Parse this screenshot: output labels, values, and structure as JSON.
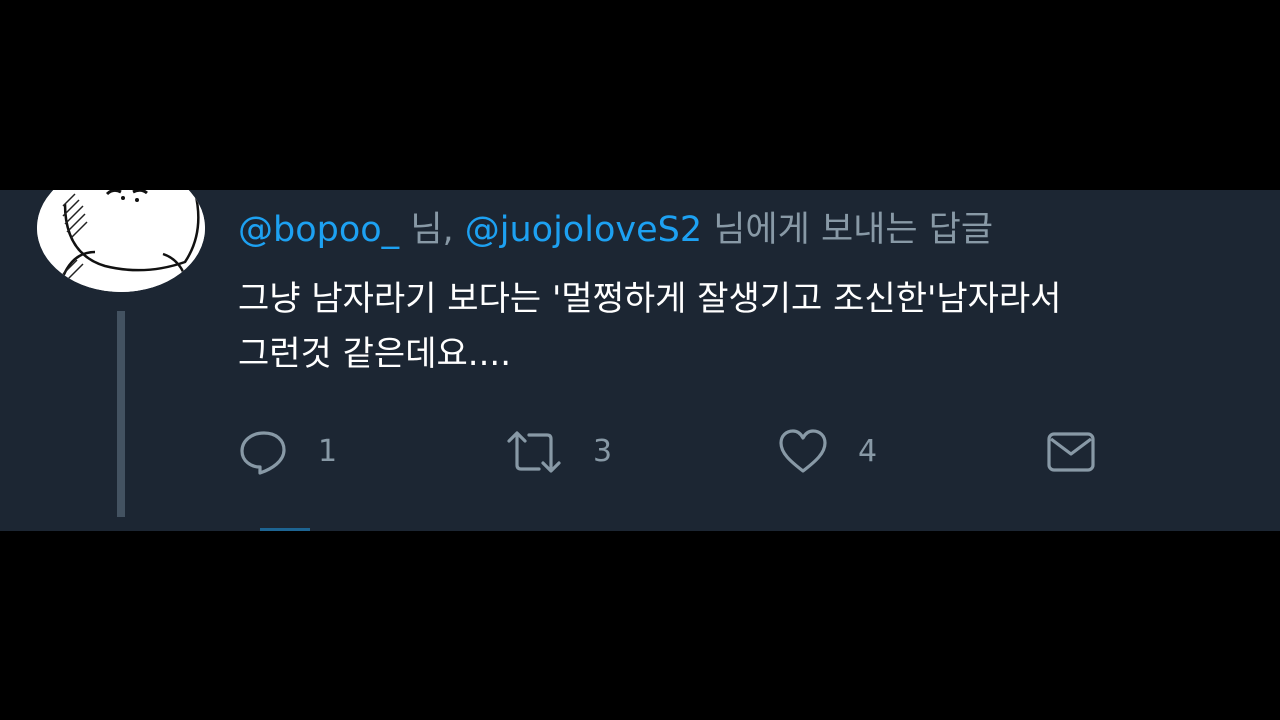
{
  "reply_header": {
    "mention_1": "@bopoo_",
    "suffix_1": " 님, ",
    "mention_2": "@juojoloveS2",
    "suffix_2": " 님에게 보내는 답글"
  },
  "tweet": {
    "text": "그냥 남자라기 보다는 '멀쩡하게 잘생기고 조신한'남자라서\n그런것 같은데요...."
  },
  "actions": {
    "reply": {
      "icon": "reply-icon",
      "count": "1"
    },
    "retweet": {
      "icon": "retweet-icon",
      "count": "3"
    },
    "like": {
      "icon": "heart-icon",
      "count": "4"
    },
    "dm": {
      "icon": "envelope-icon"
    }
  },
  "colors": {
    "background": "#1c2633",
    "mention": "#1da1f2",
    "muted": "#8899a6",
    "text": "#ffffff"
  }
}
